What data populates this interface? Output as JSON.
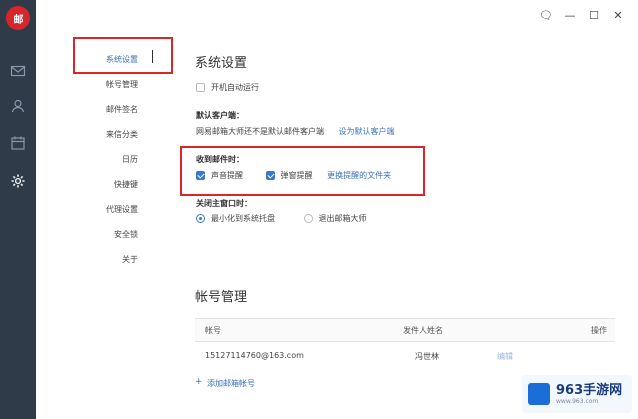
{
  "app": {
    "logo_text": "邮"
  },
  "window_controls": [
    "🗨",
    "—",
    "☐",
    "✕"
  ],
  "rail_icons": [
    "mail-icon",
    "contacts-icon",
    "calendar-icon",
    "settings-gear-icon"
  ],
  "sidebar": {
    "items": [
      {
        "label": "系统设置",
        "active": true
      },
      {
        "label": "帐号管理"
      },
      {
        "label": "邮件签名"
      },
      {
        "label": "来信分类"
      },
      {
        "label": "日历"
      },
      {
        "label": "快捷键"
      },
      {
        "label": "代理设置"
      },
      {
        "label": "安全锁"
      },
      {
        "label": "关于"
      }
    ]
  },
  "system": {
    "title": "系统设置",
    "autostart_label": "开机自动运行",
    "default_client_heading": "默认客户端：",
    "default_client_text": "网易邮箱大师还不是默认邮件客户端",
    "default_client_link": "设为默认客户端",
    "receive_heading": "收到邮件时：",
    "sound_label": "声音提醒",
    "popup_label": "弹窗提醒",
    "sound_file_link": "更换提醒的文件夹",
    "close_heading": "关闭主窗口时：",
    "minimize_label": "最小化到系统托盘",
    "exit_label": "退出邮箱大师"
  },
  "accounts": {
    "title": "帐号管理",
    "columns": [
      "帐号",
      "发件人姓名",
      "操作"
    ],
    "rows": [
      {
        "account": "15127114760@163.com",
        "sender": "冯世林",
        "action": "编辑"
      }
    ],
    "add_label": "添加邮箱帐号"
  },
  "watermark": {
    "title": "963手游网",
    "subtitle": "www.963.com"
  },
  "colors": {
    "rail": "#2f3b49",
    "accent": "#3a6fbf",
    "highlight": "#d9262b"
  }
}
